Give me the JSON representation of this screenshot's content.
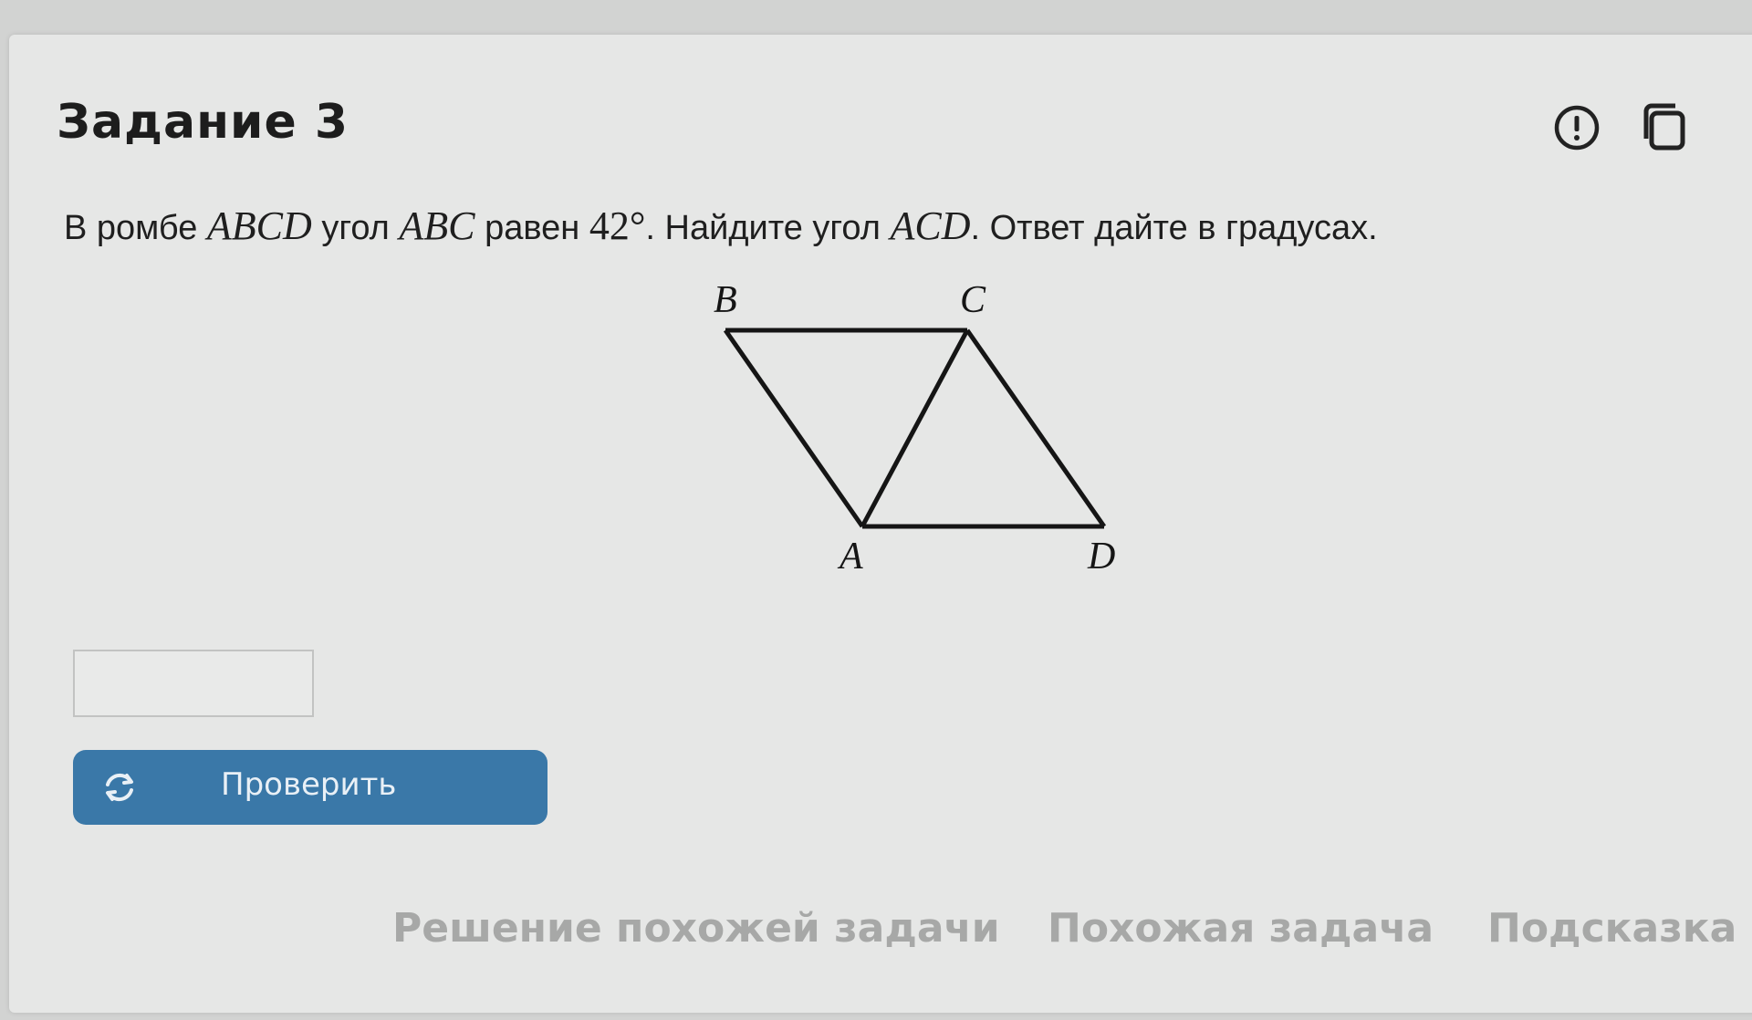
{
  "task": {
    "title": "Задание 3"
  },
  "problem": {
    "text_1": "В ромбе",
    "math_1": "ABCD",
    "text_2": "угол",
    "math_2": "ABC",
    "text_3": "равен",
    "value": "42°",
    "text_4": ". Найдите угол",
    "math_3": "ACD",
    "text_5": ". Ответ дайте в градусах."
  },
  "figure": {
    "vertices": {
      "A": "A",
      "B": "B",
      "C": "C",
      "D": "D"
    }
  },
  "answer": {
    "value": "",
    "placeholder": ""
  },
  "check_button": {
    "label": "Проверить",
    "icon": "refresh-icon"
  },
  "links": {
    "similar_solution": "Решение похожей задачи",
    "similar_task": "Похожая задача",
    "hint": "Подсказка"
  },
  "header_icons": [
    "report-icon",
    "copy-icon"
  ],
  "colors": {
    "button": "#3a78a8",
    "links": "#a7a8a7"
  }
}
